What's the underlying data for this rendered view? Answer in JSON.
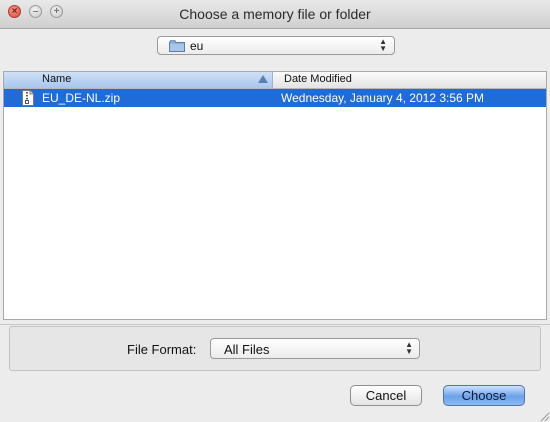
{
  "window": {
    "title": "Choose a memory file or folder"
  },
  "location": {
    "current_folder": "eu",
    "folder_icon": "folder-icon"
  },
  "browser": {
    "columns": [
      {
        "label": "Name",
        "sorted": "ascending"
      },
      {
        "label": "Date Modified"
      }
    ],
    "rows": [
      {
        "name": "EU_DE-NL.zip",
        "date_modified": "Wednesday, January 4, 2012 3:56 PM",
        "icon": "zip-file-icon",
        "selected": true
      }
    ]
  },
  "format": {
    "label": "File Format:",
    "value": "All Files"
  },
  "buttons": {
    "cancel": "Cancel",
    "choose": "Choose"
  },
  "colors": {
    "selection": "#1f6bd7",
    "default_button": "#6aa2ea"
  }
}
